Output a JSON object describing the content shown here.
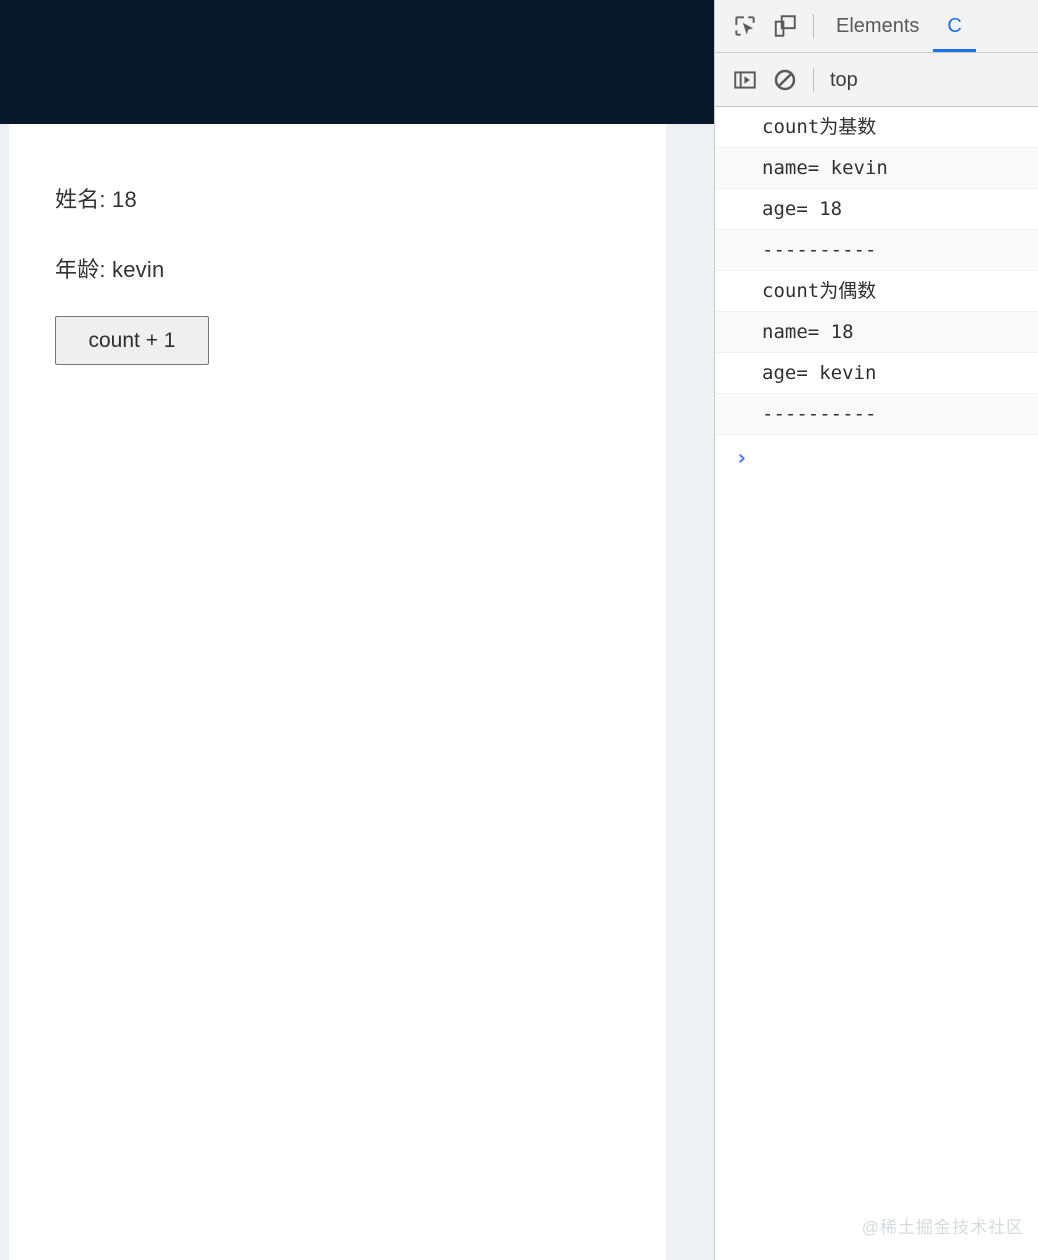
{
  "page": {
    "header_color": "#07182b",
    "lines": [
      {
        "label": "姓名:",
        "value": "18",
        "text": "姓名: 18"
      },
      {
        "label": "年龄:",
        "value": "kevin",
        "text": "年龄: kevin"
      }
    ],
    "button_label": "count + 1"
  },
  "devtools": {
    "tabs": [
      {
        "label": "Elements",
        "active": false
      },
      {
        "label": "C",
        "active": true
      }
    ],
    "toolbar_icons": [
      {
        "name": "inspect-element-icon",
        "title": "Inspect element"
      },
      {
        "name": "device-toolbar-icon",
        "title": "Toggle device toolbar"
      }
    ],
    "console_toolbar_icons": [
      {
        "name": "console-sidebar-icon",
        "title": "Show console sidebar"
      },
      {
        "name": "clear-console-icon",
        "title": "Clear console"
      }
    ],
    "context_selector": "top",
    "console_messages": [
      "count为基数",
      "name= kevin",
      "age= 18",
      "----------",
      "count为偶数",
      "name= 18",
      "age= kevin",
      "----------"
    ],
    "prompt_symbol": "›",
    "accent_color": "#1a73e8"
  },
  "watermark": "@稀土掘金技术社区"
}
